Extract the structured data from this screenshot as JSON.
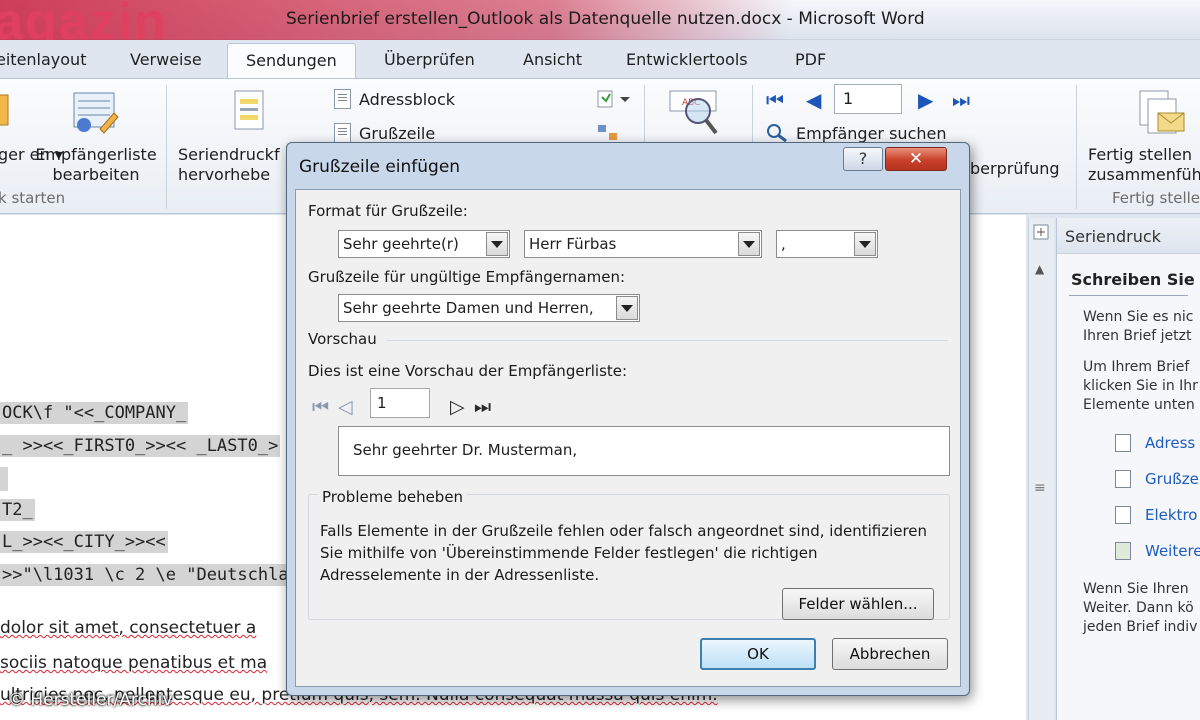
{
  "window": {
    "title": "Serienbrief erstellen_Outlook als Datenquelle nutzen.docx  -  Microsoft Word",
    "watermark": "agazin"
  },
  "tabs": [
    "eitenlayout",
    "Verweise",
    "Sendungen",
    "Überprüfen",
    "Ansicht",
    "Entwicklertools",
    "PDF"
  ],
  "active_tab": "Sendungen",
  "ribbon": {
    "btn_empfaenger_cut": "ger\nen ▾",
    "btn_empfaengerliste": "Empfängerliste\nbearbeiten",
    "group_start": "k starten",
    "btn_seriendruckfelder": "Seriendruckf\nhervorhebe",
    "btn_adressblock": "Adressblock",
    "btn_grusszeile": "Grußzeile",
    "record_number": "1",
    "btn_empfaenger_suchen": "Empfänger suchen",
    "text_ueberpruefung": "berprüfung",
    "btn_fertig_stellen": "Fertig stellen\nzusammenfüh",
    "group_fertig": "Fertig stelle"
  },
  "document": {
    "field_lines": [
      "OCK\\f \"<<_COMPANY_",
      "_ >><<_FIRST0_>><< _LAST0_>",
      "",
      "T2_",
      "L_>><<_CITY_>><<",
      ">>\"\\l1031 \\c 2 \\e \"Deutschlan"
    ],
    "body_lines": [
      " dolor sit amet, consectetuer a",
      "sociis natoque penatibus et ma",
      "ultricies nec, pellentesque eu, pretium quis, sem. Nulla consequat massa quis enim."
    ],
    "credit": "© Hersteller/Archiv"
  },
  "taskpane": {
    "title": "Seriendruck",
    "subtitle": "Schreiben Sie I",
    "para1": [
      "Wenn Sie es nic",
      "Ihren Brief jetzt"
    ],
    "para2": [
      "Um Ihrem Brief",
      "klicken Sie in Ihr",
      "Elemente unten"
    ],
    "links": [
      "Adress",
      "Grußze",
      "Elektro",
      "Weitere"
    ],
    "para3": [
      "Wenn Sie Ihren",
      "Weiter. Dann kö",
      "jeden Brief indiv"
    ]
  },
  "dialog": {
    "title": "Grußzeile einfügen",
    "help": "?",
    "close": "✕",
    "format_label": "Format für Grußzeile:",
    "salutation": "Sehr geehrte(r)",
    "name_format": "Herr Fürbas",
    "punctuation": ",",
    "invalid_label": "Grußzeile für ungültige Empfängernamen:",
    "invalid_value": "Sehr geehrte Damen und Herren,",
    "preview_heading": "Vorschau",
    "preview_label": "Dies ist eine Vorschau der Empfängerliste:",
    "preview_record": "1",
    "preview_text": "Sehr geehrter Dr. Musterman,",
    "problems_heading": "Probleme beheben",
    "problems_text": "Falls Elemente in der Grußzeile fehlen oder falsch angeordnet sind, identifizieren Sie mithilfe von 'Übereinstimmende Felder festlegen' die richtigen Adresselemente in der Adressenliste.",
    "btn_fields": "Felder wählen...",
    "btn_ok": "OK",
    "btn_cancel": "Abbrechen"
  },
  "colors": {
    "accent": "#1d5bbf",
    "close_red": "#c9412a",
    "dialog_frame": "#c8d7ea"
  }
}
